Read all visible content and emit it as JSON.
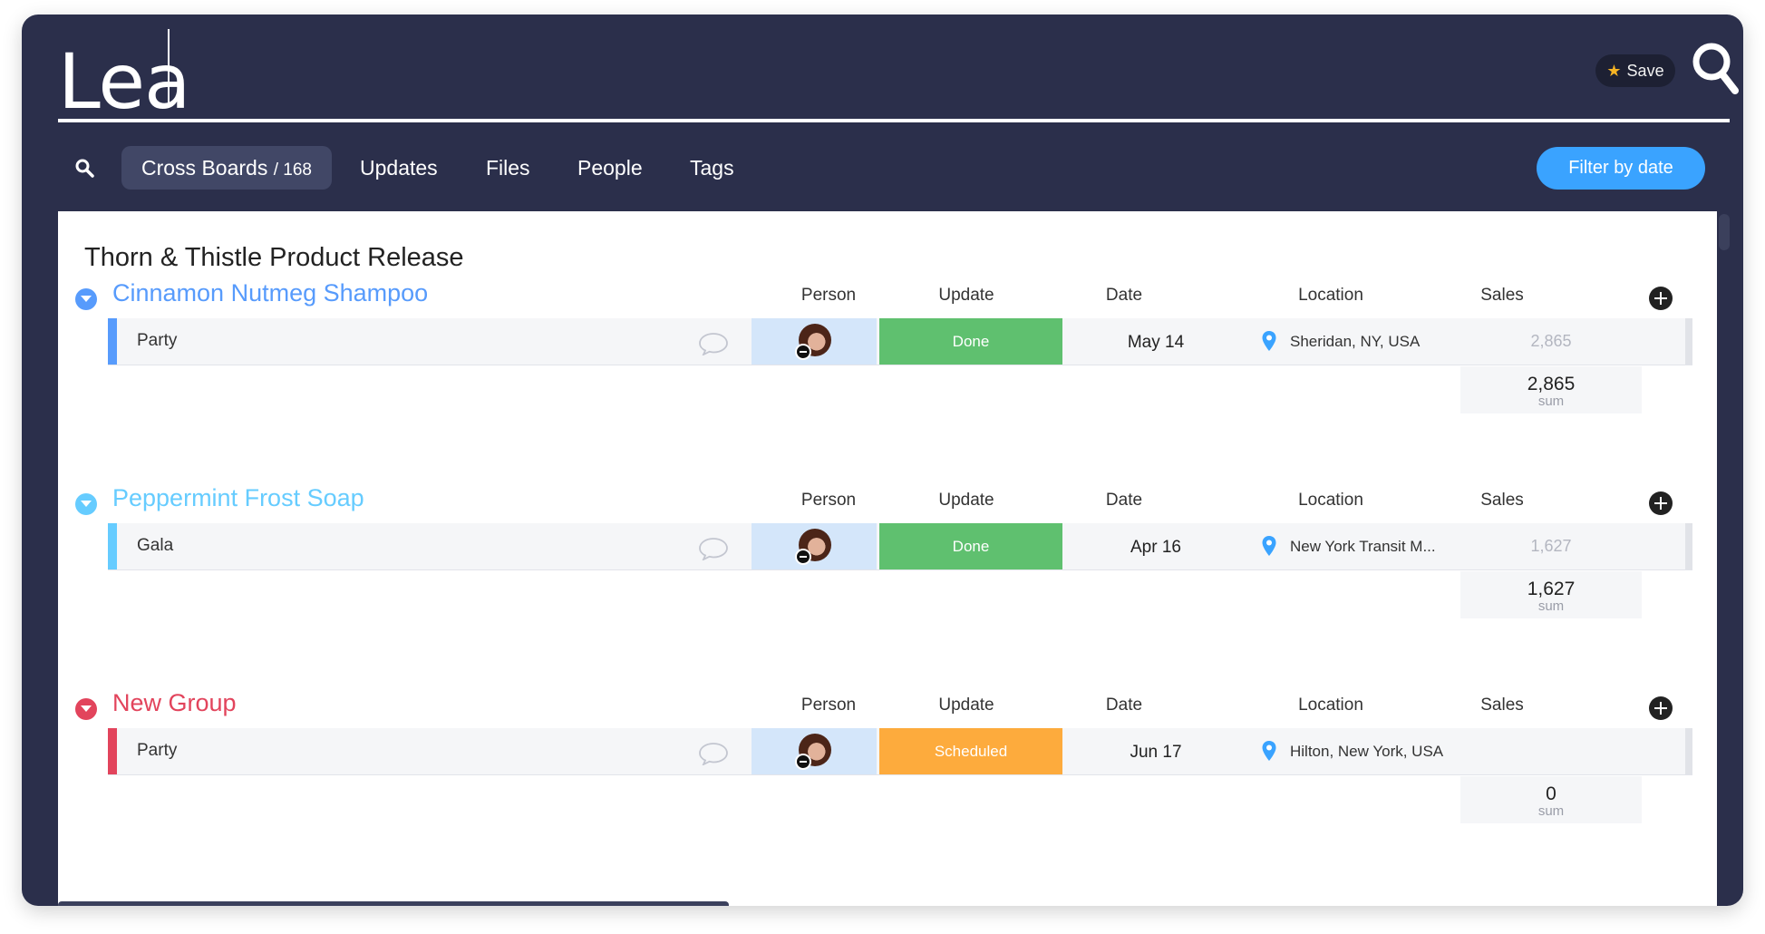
{
  "search": {
    "query": "Lea"
  },
  "header": {
    "save_label": "Save"
  },
  "tabs": [
    {
      "label": "Cross Boards",
      "count": "/ 168"
    },
    {
      "label": "Updates"
    },
    {
      "label": "Files"
    },
    {
      "label": "People"
    },
    {
      "label": "Tags"
    }
  ],
  "filter_label": "Filter by date",
  "board_title": "Thorn & Thistle Product Release",
  "columns": {
    "person": "Person",
    "update": "Update",
    "date": "Date",
    "location": "Location",
    "sales": "Sales"
  },
  "groups": [
    {
      "name": "Cinnamon Nutmeg Shampoo",
      "color": "#579bfc",
      "row": {
        "name": "Party",
        "status": "Done",
        "status_color": "#5fc06f",
        "date": "May 14",
        "location": "Sheridan, NY, USA",
        "sales": "2,865"
      },
      "sum": "2,865",
      "sum_label": "sum"
    },
    {
      "name": "Peppermint Frost Soap",
      "color": "#66ccff",
      "row": {
        "name": "Gala",
        "status": "Done",
        "status_color": "#5fc06f",
        "date": "Apr 16",
        "location": "New York Transit M...",
        "sales": "1,627"
      },
      "sum": "1,627",
      "sum_label": "sum"
    },
    {
      "name": "New Group",
      "color": "#e2445c",
      "row": {
        "name": "Party",
        "status": "Scheduled",
        "status_color": "#fdab3d",
        "date": "Jun 17",
        "location": "Hilton, New York, USA",
        "sales": ""
      },
      "sum": "0",
      "sum_label": "sum"
    }
  ],
  "icons": [
    "search-icon",
    "star-icon",
    "toggle-icon",
    "add-column-icon",
    "comment-icon",
    "avatar",
    "location-pin-icon"
  ]
}
